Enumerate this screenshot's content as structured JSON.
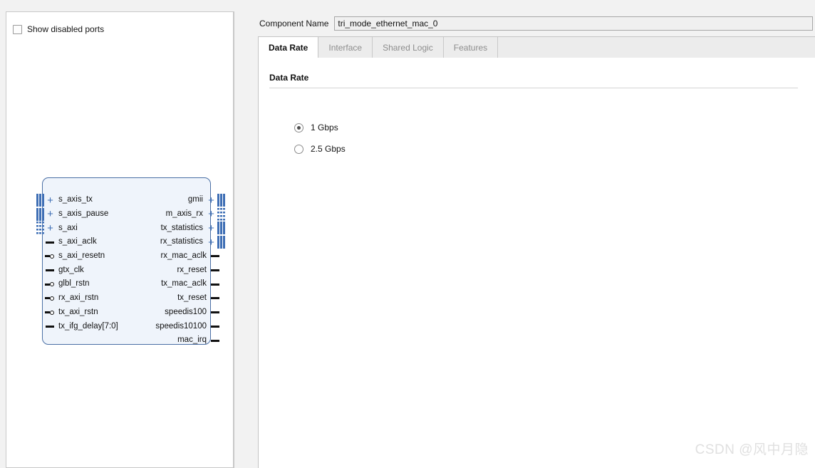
{
  "left_panel": {
    "show_disabled_ports_label": "Show disabled ports",
    "show_disabled_ports_checked": false
  },
  "symbol": {
    "left_ports": [
      {
        "name": "s_axis_tx",
        "kind": "bus"
      },
      {
        "name": "s_axis_pause",
        "kind": "bus"
      },
      {
        "name": "s_axi",
        "kind": "bus"
      },
      {
        "name": "s_axi_aclk",
        "kind": "pin"
      },
      {
        "name": "s_axi_resetn",
        "kind": "pin-lowactive"
      },
      {
        "name": "gtx_clk",
        "kind": "pin"
      },
      {
        "name": "glbl_rstn",
        "kind": "pin-lowactive"
      },
      {
        "name": "rx_axi_rstn",
        "kind": "pin-lowactive"
      },
      {
        "name": "tx_axi_rstn",
        "kind": "pin-lowactive"
      },
      {
        "name": "tx_ifg_delay[7:0]",
        "kind": "pin"
      }
    ],
    "right_ports": [
      {
        "name": "gmii",
        "kind": "bus"
      },
      {
        "name": "m_axis_rx",
        "kind": "bus"
      },
      {
        "name": "tx_statistics",
        "kind": "bus"
      },
      {
        "name": "rx_statistics",
        "kind": "bus"
      },
      {
        "name": "rx_mac_aclk",
        "kind": "pin"
      },
      {
        "name": "rx_reset",
        "kind": "pin"
      },
      {
        "name": "tx_mac_aclk",
        "kind": "pin"
      },
      {
        "name": "tx_reset",
        "kind": "pin"
      },
      {
        "name": "speedis100",
        "kind": "pin"
      },
      {
        "name": "speedis10100",
        "kind": "pin"
      },
      {
        "name": "mac_irq",
        "kind": "pin"
      }
    ],
    "colors": {
      "block_fill": "#eff4fb",
      "block_border": "#4a6fa5",
      "bus_accent": "#3f6fb5"
    }
  },
  "component_name": {
    "label": "Component Name",
    "value": "tri_mode_ethernet_mac_0"
  },
  "tabs": [
    {
      "label": "Data Rate",
      "active": true
    },
    {
      "label": "Interface",
      "active": false
    },
    {
      "label": "Shared Logic",
      "active": false
    },
    {
      "label": "Features",
      "active": false
    }
  ],
  "data_rate_section": {
    "title": "Data Rate",
    "options": [
      {
        "label": "1 Gbps",
        "selected": true
      },
      {
        "label": "2.5 Gbps",
        "selected": false
      }
    ]
  },
  "watermark": {
    "text": "CSDN @风中月隐"
  }
}
